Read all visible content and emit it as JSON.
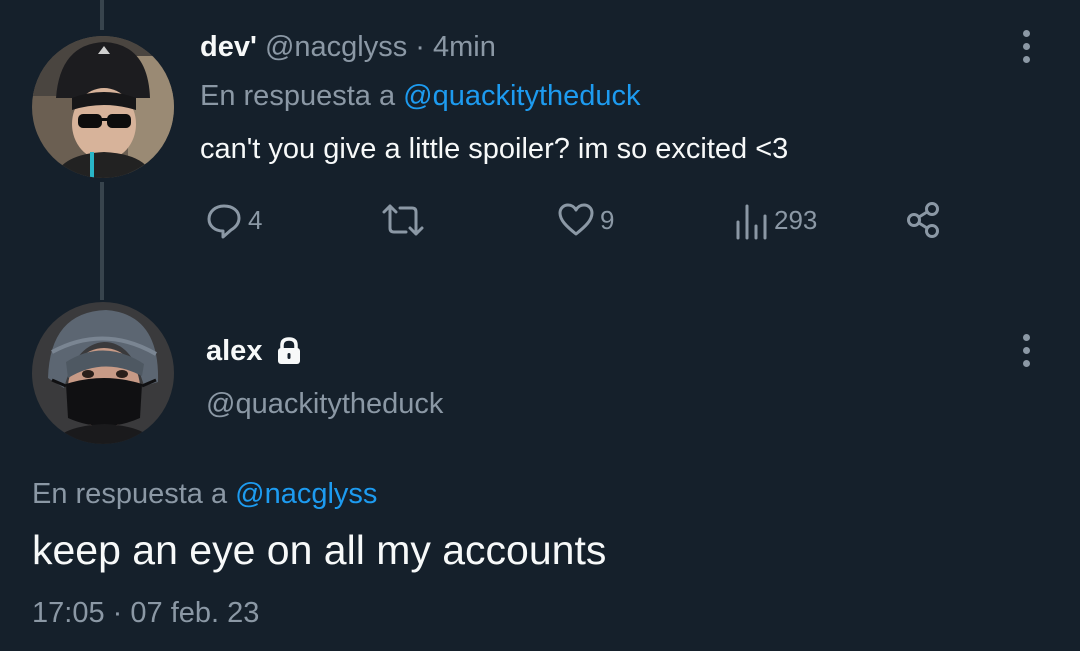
{
  "reply_tweet": {
    "display_name": "dev'",
    "handle": "@nacglyss",
    "separator": "·",
    "time_ago": "4min",
    "reply_prefix": "En respuesta a",
    "reply_to": "@quackitytheduck",
    "text": "can't you give a little spoiler? im so excited <3",
    "actions": {
      "reply_count": "4",
      "retweet_count": "",
      "like_count": "9",
      "views_count": "293"
    },
    "icons": [
      "reply-icon",
      "retweet-icon",
      "like-icon",
      "views-icon",
      "share-icon",
      "more-icon"
    ]
  },
  "main_tweet": {
    "display_name": "alex",
    "protected_icon": "lock-icon",
    "handle": "@quackitytheduck",
    "reply_prefix": "En respuesta a",
    "reply_to": "@nacglyss",
    "text": "keep an eye on all my accounts",
    "time": "17:05",
    "separator": "·",
    "date": "07 feb. 23"
  },
  "colors": {
    "background": "#15202b",
    "text": "#f7f9f9",
    "muted": "#8b98a5",
    "accent": "#1d9bf0",
    "thread_line": "#38444d"
  }
}
